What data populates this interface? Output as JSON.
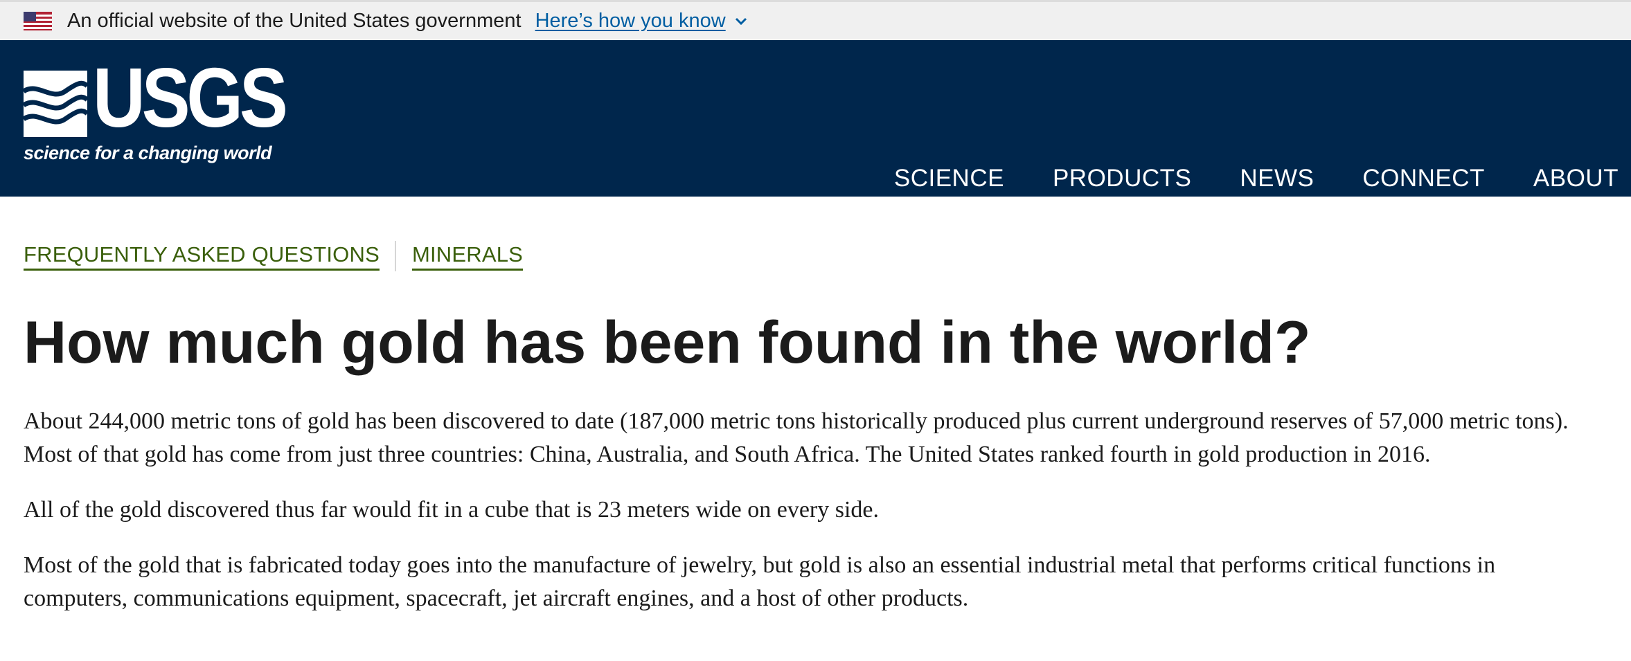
{
  "gov_banner": {
    "text": "An official website of the United States government",
    "link": "Here’s how you know",
    "flag_icon": "us-flag-icon",
    "chevron_icon": "chevron-down-icon"
  },
  "header": {
    "logo_word": "USGS",
    "logo_tagline": "science for a changing world",
    "nav": [
      "SCIENCE",
      "PRODUCTS",
      "NEWS",
      "CONNECT",
      "ABOUT"
    ]
  },
  "breadcrumbs": [
    "FREQUENTLY ASKED QUESTIONS",
    "MINERALS"
  ],
  "title": "How much gold has been found in the world?",
  "paragraphs": [
    "About 244,000 metric tons of gold has been discovered to date (187,000 metric tons historically produced plus current underground reserves of 57,000 metric tons). Most of that gold has come from just three countries: China, Australia, and South Africa. The United States ranked fourth in gold production in 2016.",
    "All of the gold discovered thus far would fit in a cube that is 23 meters wide on every side.",
    "Most of the gold that is fabricated today goes into the manufacture of jewelry, but gold is also an essential industrial metal that performs critical functions in computers, communications equipment, spacecraft, jet aircraft engines, and a host of other products."
  ],
  "colors": {
    "header_bg": "#00264c",
    "banner_bg": "#f0f0f0",
    "link_blue": "#005ea2",
    "crumb_green": "#3a5f0b"
  }
}
